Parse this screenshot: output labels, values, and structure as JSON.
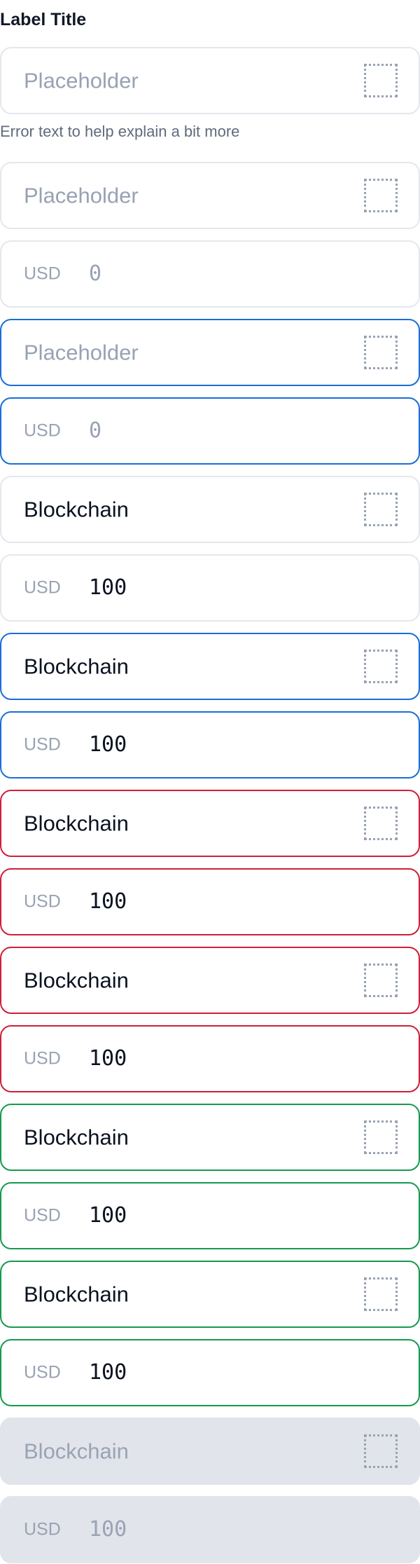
{
  "label_title": "Label Title",
  "error_text": "Error text to help explain a bit more",
  "fields": [
    {
      "kind": "text",
      "state": "default",
      "text": "Placeholder",
      "is_placeholder": true
    },
    {
      "kind": "text",
      "state": "default",
      "text": "Placeholder",
      "is_placeholder": true
    },
    {
      "kind": "currency",
      "state": "default",
      "prefix": "USD",
      "value": "0",
      "is_placeholder": true
    },
    {
      "kind": "text",
      "state": "focus",
      "text": "Placeholder",
      "is_placeholder": true
    },
    {
      "kind": "currency",
      "state": "focus",
      "prefix": "USD",
      "value": "0",
      "is_placeholder": true
    },
    {
      "kind": "text",
      "state": "default",
      "text": "Blockchain"
    },
    {
      "kind": "currency",
      "state": "default",
      "prefix": "USD",
      "value": "100"
    },
    {
      "kind": "text",
      "state": "focus",
      "text": "Blockchain"
    },
    {
      "kind": "currency",
      "state": "focus",
      "prefix": "USD",
      "value": "100"
    },
    {
      "kind": "text",
      "state": "error",
      "text": "Blockchain"
    },
    {
      "kind": "currency",
      "state": "error",
      "prefix": "USD",
      "value": "100"
    },
    {
      "kind": "text",
      "state": "error",
      "text": "Blockchain"
    },
    {
      "kind": "currency",
      "state": "error",
      "prefix": "USD",
      "value": "100"
    },
    {
      "kind": "text",
      "state": "success",
      "text": "Blockchain"
    },
    {
      "kind": "currency",
      "state": "success",
      "prefix": "USD",
      "value": "100"
    },
    {
      "kind": "text",
      "state": "success",
      "text": "Blockchain"
    },
    {
      "kind": "currency",
      "state": "success",
      "prefix": "USD",
      "value": "100"
    },
    {
      "kind": "text",
      "state": "disabled",
      "text": "Blockchain"
    },
    {
      "kind": "currency",
      "state": "disabled",
      "prefix": "USD",
      "value": "100"
    }
  ],
  "colors": {
    "border_default": "#e4e7ec",
    "border_focus": "#1a6ed8",
    "border_error": "#d01f3a",
    "border_success": "#169a4e",
    "disabled_fill": "#e1e4eb",
    "placeholder": "#98a2b3",
    "text": "#0b1220"
  },
  "icons": {
    "trailing": "dotted-square-icon"
  }
}
